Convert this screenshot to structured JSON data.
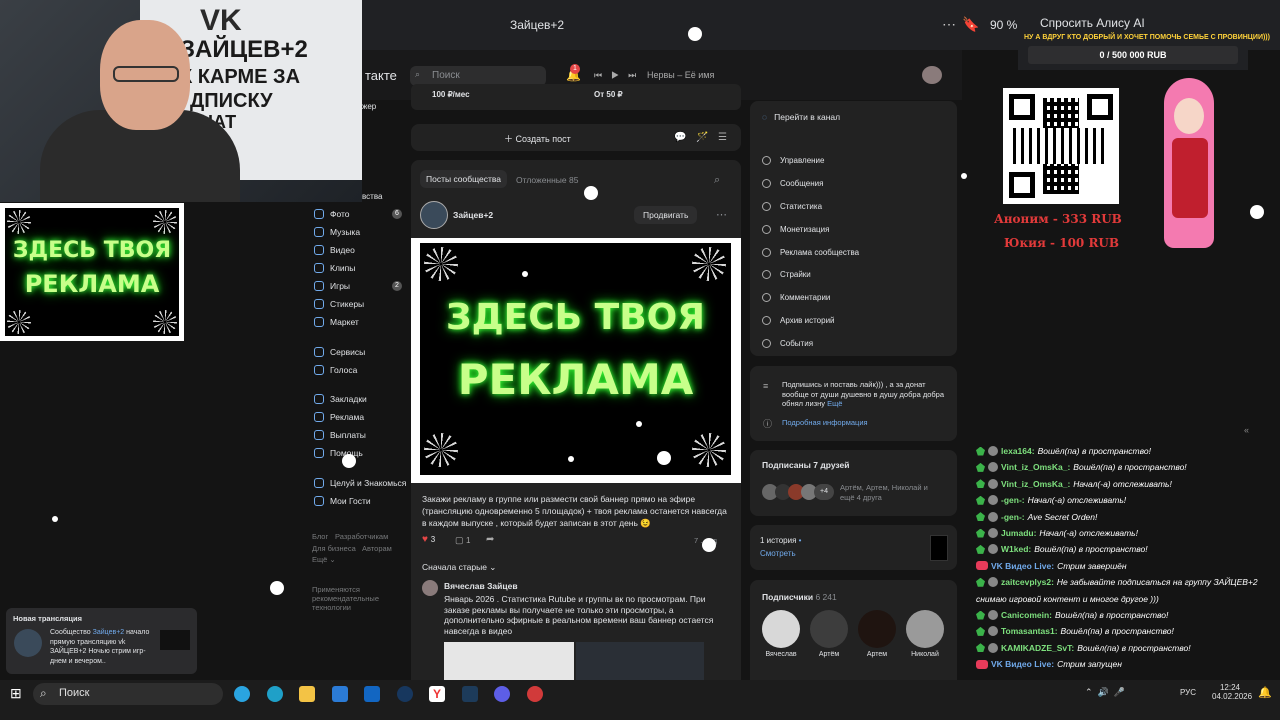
{
  "browser": {
    "tab_title": "Зайцев+2",
    "zoom": "90 %",
    "alice_label": "Спросить Алису AI"
  },
  "vk_header": {
    "logo_text": "такте",
    "search_placeholder": "Поиск",
    "notification_count": "1",
    "now_playing": "Нервы – Её имя"
  },
  "promo_strip": {
    "left_price": "100 ₽/мес",
    "right_price": "От 50 ₽"
  },
  "create_post": {
    "label": "Создать пост"
  },
  "left_menu": {
    "partial": [
      "жер",
      "вства"
    ],
    "items": [
      {
        "label": "Фото",
        "badge": "6"
      },
      {
        "label": "Музыка"
      },
      {
        "label": "Видео"
      },
      {
        "label": "Клипы"
      },
      {
        "label": "Игры",
        "badge": "2"
      },
      {
        "label": "Стикеры"
      },
      {
        "label": "Маркет"
      },
      {
        "label": "Сервисы"
      },
      {
        "label": "Голоса"
      },
      {
        "label": "Закладки"
      },
      {
        "label": "Реклама"
      },
      {
        "label": "Выплаты"
      },
      {
        "label": "Помощь"
      },
      {
        "label": "Целуй и Знакомься"
      },
      {
        "label": "Мои Гости"
      }
    ],
    "footer": [
      "Блог",
      "Разработчикам",
      "Для бизнеса",
      "Авторам",
      "Ещё ⌄"
    ],
    "rec_note": "Применяются рекомендательные технологии"
  },
  "posts": {
    "tab_community": "Посты сообщества",
    "tab_delayed": "Отложенные",
    "tab_delayed_count": "85",
    "author": "Зайцев+2",
    "promote": "Продвигать",
    "banner_line1": "ЗДЕСЬ ТВОЯ",
    "banner_line2": "РЕКЛАМА",
    "text": "Закажи рекламу в группе или размести свой баннер прямо на эфире (трансляцию одновременно 5 площадок) + твоя реклама останется навсегда в каждом выпуске , который будет записан в этот день 😉",
    "likes": "3",
    "comments": "1",
    "time": "7 ... ад",
    "sort_label": "Сначала старые",
    "comment_author": "Вячеслав Зайцев",
    "comment_text": "Январь 2026 . Статистика Rutube и группы вк по просмотрам. При заказе рекламы вы получаете не только эти просмотры, а дополнительно эфирные в реальном времени ваш баннер остается навсегда в видео"
  },
  "manage": {
    "go_to_channel": "Перейти в канал",
    "items": [
      "Управление",
      "Сообщения",
      "Статистика",
      "Монетизация",
      "Реклама сообщества",
      "Страйки",
      "Комментарии",
      "Архив историй",
      "События"
    ]
  },
  "about": {
    "text": "Подпишись и поставь лайк))) , а за донат вообще от души душевно в душу добра добра обнял лизну",
    "more": "Ещё",
    "info": "Подробная информация"
  },
  "friends": {
    "title": "Подписаны 7 друзей",
    "count_badge": "+4",
    "names": "Артём, Артем, Николай и ещё 4 друга"
  },
  "history": {
    "title": "1 история",
    "watch": "Смотреть"
  },
  "subscribers": {
    "title": "Подписчики",
    "count": "6 241",
    "names": [
      "Вячеслав",
      "Артём",
      "Артем",
      "Николай"
    ]
  },
  "webcam": {
    "poster_lines": [
      "VK",
      "ЗАЙЦЕВ+2",
      "К КАРМЕ ЗА",
      "ДПИСКУ",
      "НАТ"
    ]
  },
  "ad_box": {
    "line1": "ЗДЕСЬ ТВОЯ",
    "line2": "РЕКЛАМА"
  },
  "notification": {
    "title": "Новая трансляция",
    "body_prefix": "Сообщество",
    "community": "Зайцев+2",
    "body": "начало прямую трансляцию vk ЗАЙЦЕВ+2 Ночью стрим игр- днем и вечером.."
  },
  "donation": {
    "goal_title": "НУ А ВДРУГ КТО ДОБРЫЙ И ХОЧЕТ ПОМОЧЬ СЕМЬЕ С ПРОВИНЦИИ)))",
    "goal_amount": "0 / 500 000 RUB",
    "donor1": "Аноним - 333 RUB",
    "donor2": "Юкия - 100 RUB"
  },
  "chat": [
    {
      "user": "lexa164:",
      "msg": "Вошёл(па) в пространство!"
    },
    {
      "user": "Vint_iz_OmsKa_:",
      "msg": "Вошёл(па) в пространство!"
    },
    {
      "user": "Vint_iz_OmsKa_:",
      "msg": "Начал(-а) отслеживать!"
    },
    {
      "user": "-gen-:",
      "msg": "Начал(-а) отслеживать!"
    },
    {
      "user": "-gen-:",
      "msg": "Ave Secret Orden!"
    },
    {
      "user": "Jumadu:",
      "msg": "Начал(-а) отслеживать!"
    },
    {
      "user": "W1ked:",
      "msg": "Вошёл(па) в пространство!"
    },
    {
      "user": "VK Видео Live:",
      "msg": "Стрим завершён",
      "live": true
    },
    {
      "user": "zaitcevplys2:",
      "msg": "Не забывайте подписаться на группу ЗАЙЦЕВ+2"
    },
    {
      "user": "",
      "msg": "снимаю игровой контент и многое другое )))"
    },
    {
      "user": "Canicomein:",
      "msg": "Вошёл(па) в пространство!"
    },
    {
      "user": "Tomasantas1:",
      "msg": "Вошёл(па) в пространство!"
    },
    {
      "user": "KAMIKADZE_SvT:",
      "msg": "Вошёл(па) в пространство!"
    },
    {
      "user": "VK Видео Live:",
      "msg": "Стрим запущен",
      "live": true
    }
  ],
  "taskbar": {
    "search": "Поиск",
    "lang": "РУС",
    "time": "12:24",
    "date": "04.02.2026"
  }
}
